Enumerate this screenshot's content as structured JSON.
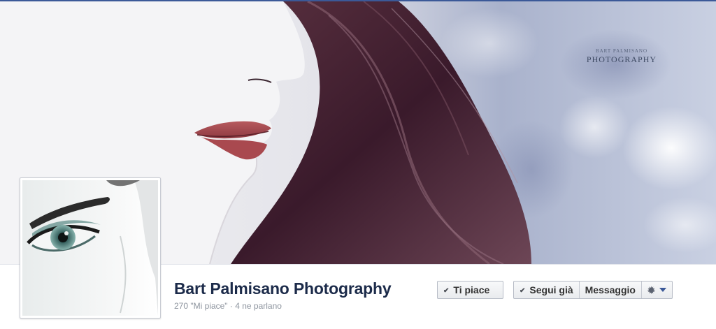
{
  "cover": {
    "watermark_line1": "BART PALMISANO",
    "watermark_line2": "PHOTOGRAPHY"
  },
  "page": {
    "name": "Bart Palmisano Photography",
    "stats": "270 \"Mi piace\" · 4 ne parlano"
  },
  "actions": {
    "like_label": "Ti piace",
    "follow_label": "Segui già",
    "message_label": "Messaggio",
    "check_icon": "checkmark-icon",
    "gear_icon": "gear-icon",
    "caret_icon": "chevron-down-icon"
  },
  "colors": {
    "brand_blue": "#3b5998",
    "name_text": "#1c2b4a",
    "stats_text": "#8d949e"
  }
}
